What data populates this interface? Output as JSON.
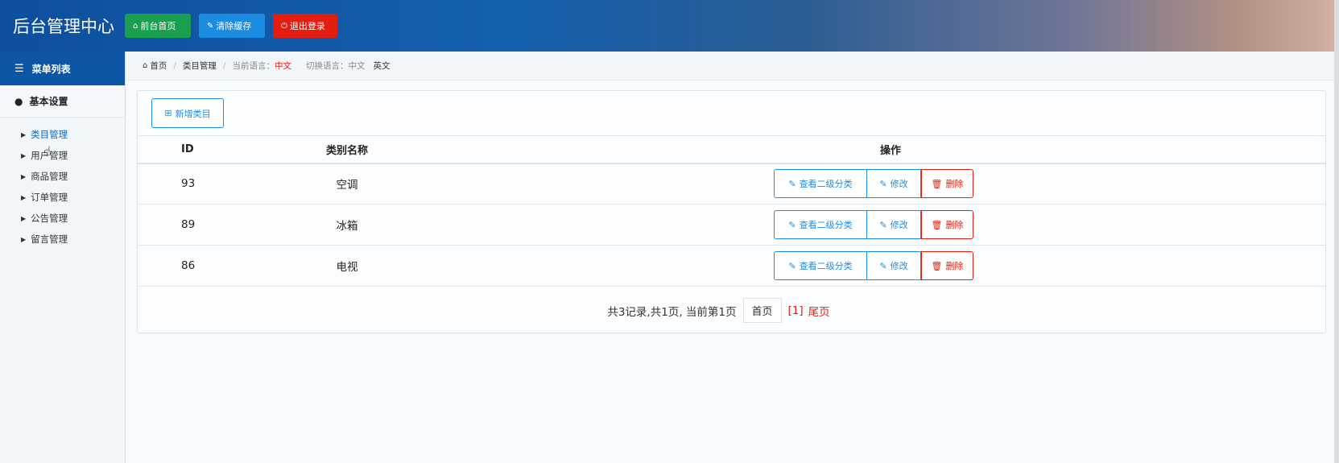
{
  "header": {
    "title": "后台管理中心",
    "buttons": [
      {
        "icon": "home-icon",
        "glyph": "⌂",
        "label": "前台首页",
        "color": "#18a04f"
      },
      {
        "icon": "wrench-icon",
        "glyph": "✎",
        "label": "清除缓存",
        "color": "#1a8de0"
      },
      {
        "icon": "power-icon",
        "glyph": "⏻",
        "label": "退出登录",
        "color": "#e31e10"
      }
    ]
  },
  "sidebar": {
    "heading": "菜单列表",
    "heading_icon": "list-icon",
    "group": "基本设置",
    "group_icon": "user-icon",
    "items": [
      {
        "label": "类目管理"
      },
      {
        "label": "用户管理"
      },
      {
        "label": "商品管理"
      },
      {
        "label": "订单管理"
      },
      {
        "label": "公告管理"
      },
      {
        "label": "留言管理"
      }
    ]
  },
  "breadcrumb": {
    "home": "首页",
    "section": "类目管理",
    "lang_label": "当前语言：",
    "lang_value": "中文",
    "switch_label": "切换语言：中文",
    "switch_en": "英文"
  },
  "toolbar": {
    "add_label": "新增类目"
  },
  "table": {
    "headers": {
      "id": "ID",
      "name": "类别名称",
      "op": "操作"
    },
    "rows": [
      {
        "id": "93",
        "name": "空调"
      },
      {
        "id": "89",
        "name": "冰箱"
      },
      {
        "id": "86",
        "name": "电视"
      }
    ],
    "actions": {
      "view": "查看二级分类",
      "edit": "修改",
      "delete": "删除"
    }
  },
  "pager": {
    "summary": "共3记录,共1页, 当前第1页",
    "first": "首页",
    "current": "[1]",
    "last": "尾页"
  },
  "colors": {
    "primary": "#0d56a6",
    "accent": "#1a8de0",
    "danger": "#e31e10",
    "success": "#18a04f"
  }
}
